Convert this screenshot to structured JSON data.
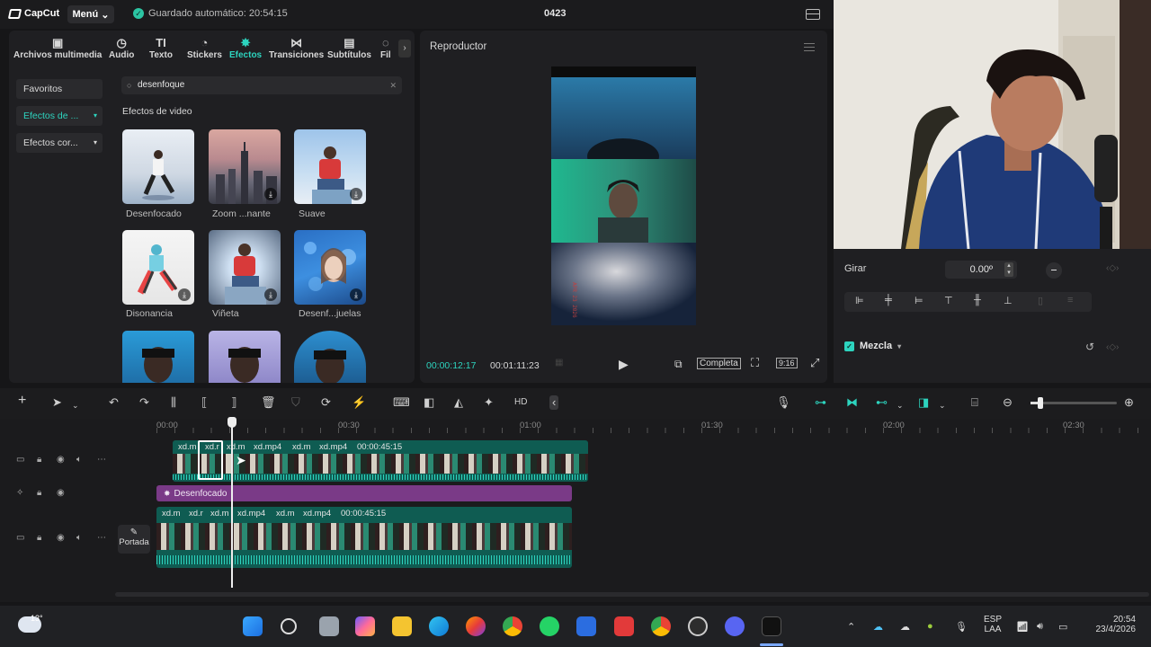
{
  "topbar": {
    "logo": "CapCut",
    "menu_label": "Menú",
    "autosave": "Guardado automático: 20:54:15",
    "project_name": "0423"
  },
  "tools": [
    {
      "label": "Archivos multimedia",
      "icon": "media-icon"
    },
    {
      "label": "Audio",
      "icon": "audio-icon"
    },
    {
      "label": "Texto",
      "icon": "text-icon"
    },
    {
      "label": "Stickers",
      "icon": "sticker-icon"
    },
    {
      "label": "Efectos",
      "icon": "effects-icon",
      "active": true
    },
    {
      "label": "Transiciones",
      "icon": "transitions-icon"
    },
    {
      "label": "Subtítulos",
      "icon": "subtitles-icon"
    },
    {
      "label": "Fil",
      "icon": "filters-icon"
    }
  ],
  "sidebar": {
    "items": [
      {
        "label": "Favoritos"
      },
      {
        "label": "Efectos de ...",
        "active": true
      },
      {
        "label": "Efectos cor..."
      }
    ]
  },
  "search": {
    "value": "desenfoque"
  },
  "effects": {
    "section_title": "Efectos de video",
    "items": [
      {
        "label": "Desenfocado"
      },
      {
        "label": "Zoom ...nante"
      },
      {
        "label": "Suave"
      },
      {
        "label": "Disonancia"
      },
      {
        "label": "Viñeta"
      },
      {
        "label": "Desenf...juelas"
      }
    ]
  },
  "player": {
    "title": "Reproductor",
    "current_time": "00:00:12:17",
    "total_time": "00:01:11:23",
    "quality_label": "Completa",
    "ratio_label": "9:16"
  },
  "inspector": {
    "rotate_label": "Girar",
    "rotate_value": "0.00º",
    "blend_label": "Mezcla"
  },
  "ruler": {
    "ticks": [
      "00:00",
      "00:30",
      "01:00",
      "01:30",
      "02:00",
      "02:30"
    ]
  },
  "tracks": {
    "top_clips": [
      "xd.m",
      "xd.r",
      "xd.m",
      "xd.mp4",
      "xd.m",
      "xd.mp4"
    ],
    "top_duration": "00:00:45:15",
    "effect_label": "Desenfocado",
    "main_clips": [
      "xd.m",
      "xd.r",
      "xd.m",
      "xd.mp4",
      "xd.m",
      "xd.mp4"
    ],
    "main_duration": "00:00:45:15",
    "cover_label": "Portada"
  },
  "taskbar": {
    "weather": "13°",
    "lang_top": "ESP",
    "lang_bottom": "LAA",
    "time": "20:54",
    "date": "23/4/2026"
  },
  "colors": {
    "accent": "#2dd4bf",
    "effect_track": "#7a3a87",
    "clip_track": "#0f5c52"
  }
}
